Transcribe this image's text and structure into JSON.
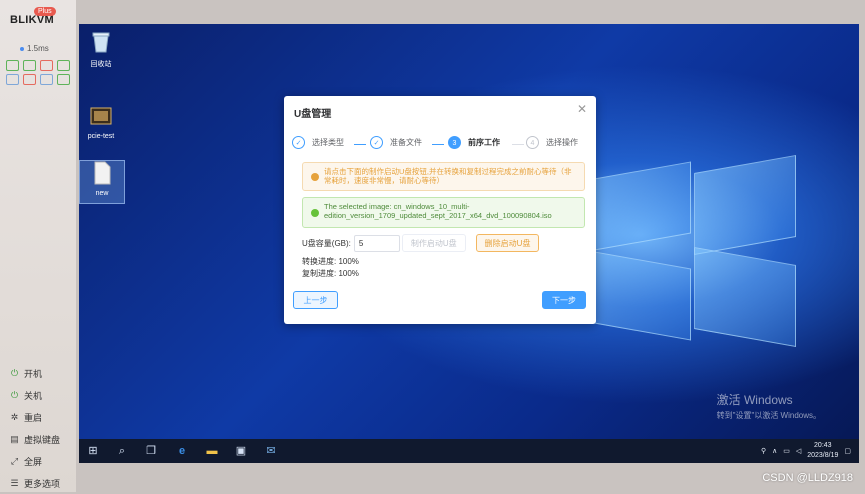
{
  "kvm": {
    "logo": "BLIKVM",
    "badge": "Plus",
    "latency": "1.5ms",
    "menu": [
      {
        "icon": "power-on-icon",
        "label": "开机"
      },
      {
        "icon": "power-off-icon",
        "label": "关机"
      },
      {
        "icon": "restart-icon",
        "label": "重启"
      },
      {
        "icon": "virtual-disk-icon",
        "label": "虚拟键盘"
      },
      {
        "icon": "fullscreen-icon",
        "label": "全屏"
      },
      {
        "icon": "more-options-icon",
        "label": "更多选项"
      }
    ]
  },
  "desktop": {
    "icons": [
      {
        "icon": "recycle-bin-icon",
        "label": "回收站"
      },
      {
        "icon": "image-file-icon",
        "label": "pcie-test"
      },
      {
        "icon": "blank-file-icon",
        "label": "new"
      }
    ],
    "activate_title": "激活 Windows",
    "activate_sub": "转到\"设置\"以激活 Windows。"
  },
  "taskbar": {
    "icons": [
      "windows-start-icon",
      "search-icon",
      "task-view-icon",
      "edge-icon",
      "file-explorer-icon",
      "store-icon",
      "mail-icon"
    ],
    "clock_time": "20:43",
    "clock_date": "2023/8/19"
  },
  "dialog": {
    "title": "U盘管理",
    "steps": [
      {
        "label": "选择类型",
        "state": "done",
        "mark": "✓"
      },
      {
        "label": "准备文件",
        "state": "done",
        "mark": "✓"
      },
      {
        "label": "前序工作",
        "state": "active",
        "mark": "3"
      },
      {
        "label": "选择操作",
        "state": "wait",
        "mark": "4"
      }
    ],
    "warning_text": "请点击下面的制作启动U盘按钮,并在转换和复制过程完成之前耐心等待（非常耗时，速度非常慢，请耐心等待）",
    "success_text": "The selected image: cn_windows_10_multi-edition_version_1709_updated_sept_2017_x64_dvd_100090804.iso",
    "capacity_label": "U盘容量(GB):",
    "capacity_value": "5",
    "make_button": "制作启动U盘",
    "delete_button": "删除启动U盘",
    "convert_progress": "转换进度: 100%",
    "copy_progress": "复制进度: 100%",
    "prev_button": "上一步",
    "next_button": "下一步"
  },
  "watermark": "CSDN @LLDZ918"
}
